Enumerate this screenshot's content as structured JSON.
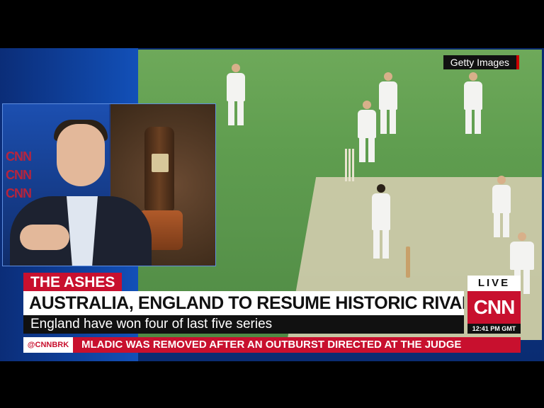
{
  "credit": "Getty Images",
  "inset": {
    "wall_text": [
      "CNN",
      "CNN",
      "CNN"
    ]
  },
  "banner": {
    "tag": "THE ASHES",
    "headline": "AUSTRALIA, ENGLAND TO RESUME HISTORIC RIVALRY",
    "subline": "England have won four of last five series"
  },
  "bug": {
    "live": "LIVE",
    "logo": "CNN",
    "time": "12:41 PM GMT"
  },
  "ticker": {
    "label": "@CNNBRK",
    "text": "MLADIC WAS REMOVED AFTER AN OUTBURST DIRECTED AT THE JUDGE"
  },
  "colors": {
    "cnn_red": "#c8102e",
    "banner_white": "#ffffff",
    "frame_blue": "#0d3a8f"
  }
}
